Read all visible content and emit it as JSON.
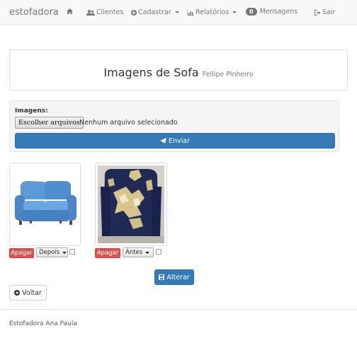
{
  "navbar": {
    "brand": "estofadora",
    "items": [
      {
        "icon": "home-icon",
        "label": ""
      },
      {
        "icon": "users-icon",
        "label": "Clientes"
      },
      {
        "icon": "plus-circle-icon",
        "label": "Cadastrar",
        "dropdown": true
      },
      {
        "icon": "bar-chart-icon",
        "label": "Relatórios",
        "dropdown": true
      },
      {
        "icon": "badge",
        "label": "Mensagens",
        "badge": "0"
      },
      {
        "icon": "sign-out-icon",
        "label": "Sair"
      }
    ]
  },
  "header": {
    "title": "Imagens de Sofa",
    "subtitle": "Fellipe Pinheiro"
  },
  "upload": {
    "label": "Imagens:",
    "file_button": "Escolher arquivos",
    "file_status": "Nenhum arquivo selecionado",
    "submit_label": "Enviar"
  },
  "images": [
    {
      "delete_label": "Apagar",
      "stage": "Depois",
      "checked": false,
      "picture": "blue sofa"
    },
    {
      "delete_label": "Apagar",
      "stage": "Antes",
      "checked": false,
      "picture": "damaged armchair"
    }
  ],
  "actions": {
    "alter_label": "Alterar",
    "back_label": "Voltar"
  },
  "footer": {
    "text": "Estofadora Ana Paula"
  },
  "colors": {
    "primary": "#337ab7",
    "danger": "#d9534f",
    "navbar_bg": "#f8f8f8"
  }
}
